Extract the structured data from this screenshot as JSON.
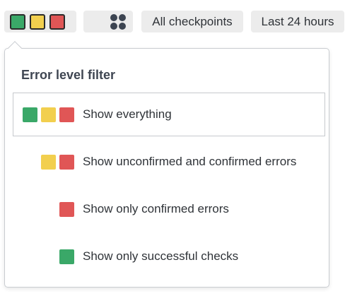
{
  "colors": {
    "green": "#3aa868",
    "yellow": "#f2cf4e",
    "red": "#e05656",
    "dots": "#3c4451"
  },
  "toolbar": {
    "level_button": {
      "icons": [
        "green-square-icon",
        "yellow-square-icon",
        "red-square-icon"
      ]
    },
    "grid_button": {
      "icon": "four-dots-grid-icon"
    },
    "checkpoints_label": "All checkpoints",
    "range_label": "Last 24 hours"
  },
  "popover": {
    "title": "Error level filter",
    "options": [
      {
        "label": "Show everything",
        "swatches": [
          "green",
          "yellow",
          "red"
        ],
        "selected": true
      },
      {
        "label": "Show unconfirmed and confirmed errors",
        "swatches": [
          "yellow",
          "red"
        ],
        "selected": false
      },
      {
        "label": "Show only confirmed errors",
        "swatches": [
          "red"
        ],
        "selected": false
      },
      {
        "label": "Show only successful checks",
        "swatches": [
          "green"
        ],
        "selected": false
      }
    ]
  }
}
